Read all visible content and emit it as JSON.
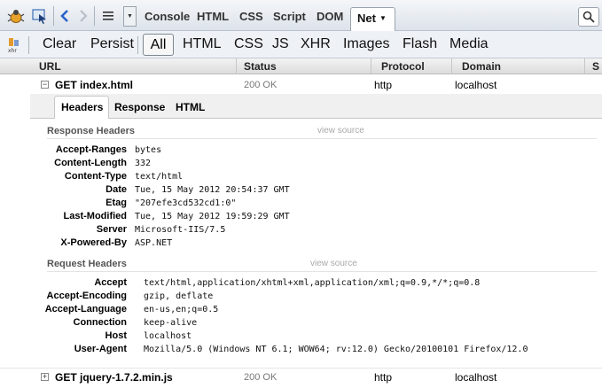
{
  "toolbar": {
    "tabs": [
      "Console",
      "HTML",
      "CSS",
      "Script",
      "DOM"
    ],
    "active_tab": "Net"
  },
  "filter_bar": {
    "clear_label": "Clear",
    "persist_label": "Persist",
    "all_label": "All",
    "filters": [
      "HTML",
      "CSS",
      "JS",
      "XHR",
      "Images",
      "Flash",
      "Media"
    ]
  },
  "columns": {
    "url": "URL",
    "status": "Status",
    "protocol": "Protocol",
    "domain": "Domain",
    "size": "S"
  },
  "requests": [
    {
      "url": "GET index.html",
      "status": "200 OK",
      "protocol": "http",
      "domain": "localhost",
      "expander": "−"
    },
    {
      "url": "GET jquery-1.7.2.min.js",
      "status": "200 OK",
      "protocol": "http",
      "domain": "localhost",
      "expander": "+"
    }
  ],
  "detail": {
    "tabs": [
      "Headers",
      "Response",
      "HTML"
    ],
    "view_source": "view source",
    "response_title": "Response Headers",
    "response_headers": [
      {
        "name": "Accept-Ranges",
        "value": "bytes"
      },
      {
        "name": "Content-Length",
        "value": "332"
      },
      {
        "name": "Content-Type",
        "value": "text/html"
      },
      {
        "name": "Date",
        "value": "Tue, 15 May 2012 20:54:37 GMT"
      },
      {
        "name": "Etag",
        "value": "\"207efe3cd532cd1:0\""
      },
      {
        "name": "Last-Modified",
        "value": "Tue, 15 May 2012 19:59:29 GMT"
      },
      {
        "name": "Server",
        "value": "Microsoft-IIS/7.5"
      },
      {
        "name": "X-Powered-By",
        "value": "ASP.NET"
      }
    ],
    "request_title": "Request Headers",
    "request_headers": [
      {
        "name": "Accept",
        "value": "text/html,application/xhtml+xml,application/xml;q=0.9,*/*;q=0.8"
      },
      {
        "name": "Accept-Encoding",
        "value": "gzip, deflate"
      },
      {
        "name": "Accept-Language",
        "value": "en-us,en;q=0.5"
      },
      {
        "name": "Connection",
        "value": "keep-alive"
      },
      {
        "name": "Host",
        "value": "localhost"
      },
      {
        "name": "User-Agent",
        "value": "Mozilla/5.0 (Windows NT 6.1; WOW64; rv:12.0) Gecko/20100101 Firefox/12.0"
      }
    ]
  },
  "icons": {
    "firebug": "firebug-icon",
    "inspect": "inspect-icon",
    "back": "back-arrow-icon",
    "forward": "forward-arrow-icon",
    "menu": "menu-icon",
    "search": "search-icon",
    "xhr": "xhr-icon"
  },
  "colors": {
    "accent": "#2a62c9",
    "toolbar": "#e4e9ef",
    "muted": "#a9a9a9"
  }
}
